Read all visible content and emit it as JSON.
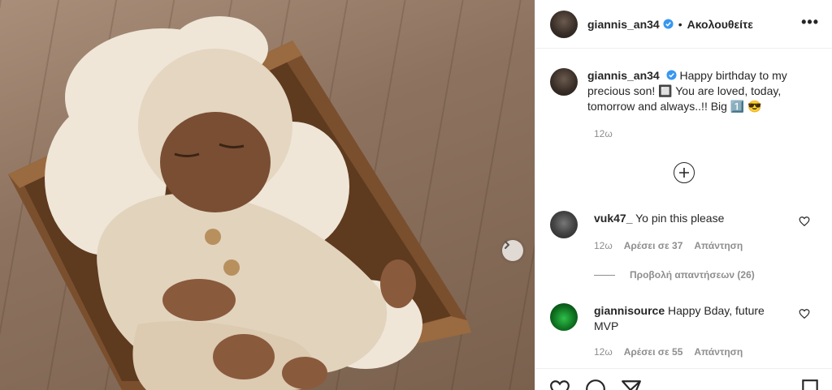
{
  "post": {
    "author": "giannis_an34",
    "follow_status": "Ακολουθείτε",
    "more_icon": "more-options-icon",
    "caption": "Happy birthday to my precious son! 🔲 You are loved, today, tomorrow and always..!! Big 1️⃣ 😎",
    "caption_time": "12ω"
  },
  "comments": [
    {
      "user": "vuk47_",
      "text": "Yo pin this please",
      "time": "12ω",
      "likes": "Αρέσει σε 37",
      "reply": "Απάντηση"
    },
    {
      "user": "giannisource",
      "text": "Happy Bday, future MVP",
      "time": "12ω",
      "likes": "Αρέσει σε 55",
      "reply": "Απάντηση"
    }
  ],
  "view_replies": "Προβολή απαντήσεων (26)",
  "colors": {
    "verified": "#3897f0",
    "meta": "#8e8e8e",
    "text": "#262626"
  }
}
